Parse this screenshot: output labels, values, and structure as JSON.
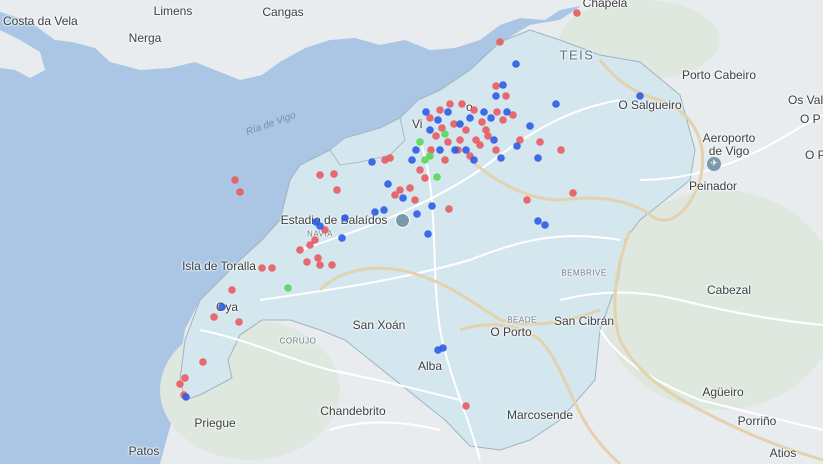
{
  "map": {
    "colors": {
      "water": "#aac6e4",
      "land": "#e9ecef",
      "city_area": "#d4e6ee",
      "road": "#ffffff",
      "highway": "#e3d2ad",
      "red_marker": "#e95a60",
      "blue_marker": "#2e5be6",
      "green_marker": "#5ad65a"
    },
    "labels": {
      "costa_da_vela": "Costa da Vela",
      "limens": "Limens",
      "cangas": "Cangas",
      "nerga": "Nerga",
      "chapela": "Chapela",
      "teis": "TEIS",
      "porto_cabeiro": "Porto Cabeiro",
      "o_salgueiro": "O Salgueiro",
      "os_valo": "Os Valo",
      "o_p1": "O P",
      "o_p2": "O P",
      "ria_de_vigo": "Ría de Vigo",
      "vigo_fragment": "Vi",
      "vigo_fragment2": "o",
      "aeroporto": "Aeroporto\nde Vigo",
      "peinador": "Peinador",
      "estadio": "Estadio de Balaídos",
      "navia": "NAVIA",
      "isla_de_toralla": "Isla de Toralla",
      "oya": "Oya",
      "bembrive": "BEMBRIVE",
      "cabezal": "Cabezal",
      "san_xoan": "San Xoán",
      "beade": "BEADE",
      "san_cibran": "San Cibrán",
      "o_porto": "O Porto",
      "corujo": "CORUJO",
      "alba": "Alba",
      "chandebrito": "Chandebrito",
      "marcosende": "Marcosende",
      "agueiro": "Agüeiro",
      "priegue": "Priegue",
      "porrino": "Porriño",
      "patos": "Patos",
      "atios": "Atios"
    },
    "icons": [
      "stadium-icon",
      "airport-icon"
    ]
  }
}
